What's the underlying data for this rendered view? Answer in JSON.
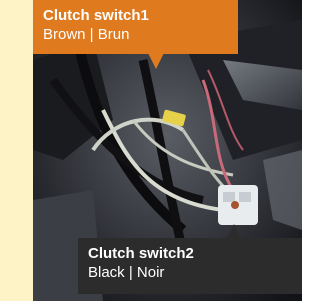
{
  "callouts": {
    "top": {
      "title": "Clutch switch1",
      "subtitle": "Brown | Brun",
      "color": "#e07a1e"
    },
    "bottom": {
      "title": "Clutch switch2",
      "subtitle": "Black | Noir",
      "color": "#2c2c2c"
    }
  },
  "colors": {
    "background": "#fdf3c6"
  }
}
